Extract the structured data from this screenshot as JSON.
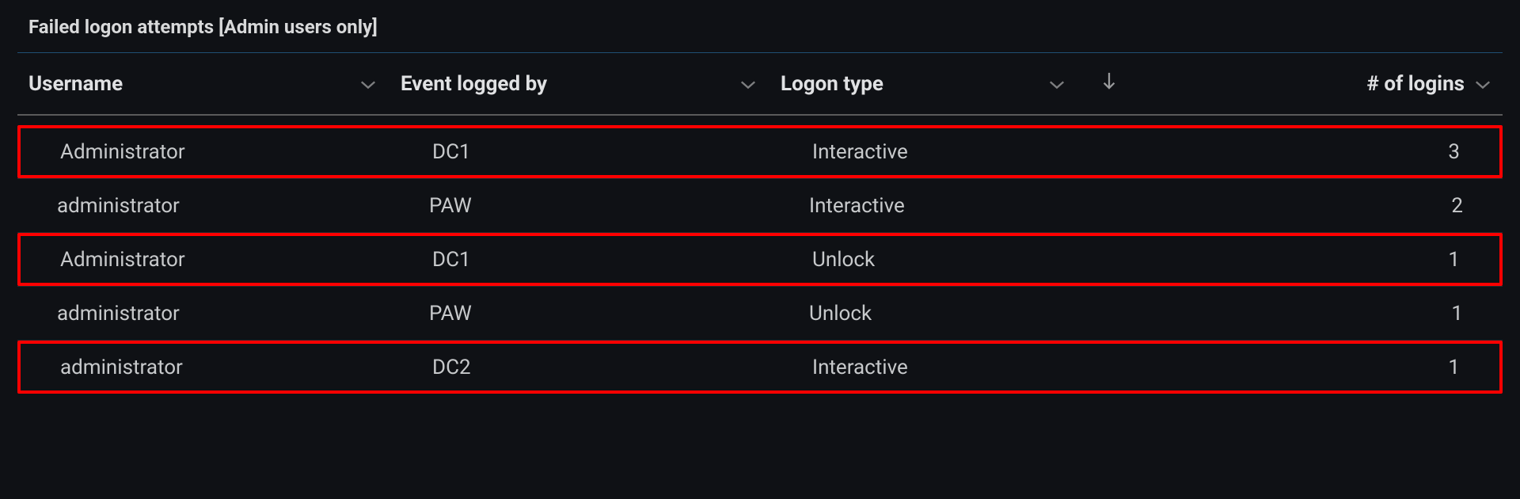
{
  "panel": {
    "title": "Failed logon attempts [Admin users only]"
  },
  "columns": {
    "username": "Username",
    "event_logged_by": "Event logged by",
    "logon_type": "Logon type",
    "num_logins": "# of logins"
  },
  "rows": [
    {
      "username": "Administrator",
      "logged_by": "DC1",
      "logon_type": "Interactive",
      "logins": "3",
      "highlighted": true
    },
    {
      "username": "administrator",
      "logged_by": "PAW",
      "logon_type": "Interactive",
      "logins": "2",
      "highlighted": false
    },
    {
      "username": "Administrator",
      "logged_by": "DC1",
      "logon_type": "Unlock",
      "logins": "1",
      "highlighted": true
    },
    {
      "username": "administrator",
      "logged_by": "PAW",
      "logon_type": "Unlock",
      "logins": "1",
      "highlighted": false
    },
    {
      "username": "administrator",
      "logged_by": "DC2",
      "logon_type": "Interactive",
      "logins": "1",
      "highlighted": true
    }
  ]
}
